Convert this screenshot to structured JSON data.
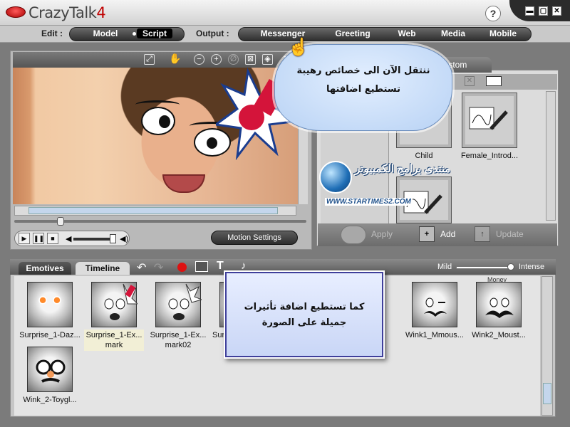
{
  "app": {
    "title_main": "CrazyTalk",
    "title_version": "4",
    "help": "?"
  },
  "window_controls": {
    "minimize": "▬",
    "maximize": "▢",
    "close": "✕"
  },
  "modebar": {
    "edit_label": "Edit :",
    "edit_items": [
      "Model",
      "Script"
    ],
    "output_label": "Output :",
    "output_items": [
      "Messenger",
      "Greeting",
      "Web",
      "Media",
      "Mobile"
    ],
    "selected": "Script"
  },
  "viewer": {
    "zoom_partial": "1",
    "motion_settings": "Motion Settings"
  },
  "library": {
    "tab_label": "Custom",
    "items": [
      {
        "label": "Child"
      },
      {
        "label": "Female_Introd..."
      }
    ],
    "actions": {
      "apply": "Apply",
      "add": "Add",
      "update": "Update"
    }
  },
  "watermark": {
    "text_arabic": "منتدى برامج الكمبيوتر",
    "url": "WWW.STARTIMES2.COM"
  },
  "callouts": {
    "cloud_line1": "ننتقل الآن الى خصائص رهيبة",
    "cloud_line2": "تستطيع اضافتها",
    "box_line1": "كما تستطيع اضافة تأثيرات",
    "box_line2": "جميلة على الصورة"
  },
  "bottom": {
    "tabs": [
      "Emotives",
      "Timeline"
    ],
    "intensity_low": "Mild",
    "intensity_high": "Intense",
    "partial_label": "Money",
    "faces": [
      {
        "line1": "Surprise_1-Daz...",
        "line2": ""
      },
      {
        "line1": "Surprise_1-Ex...",
        "line2": "mark"
      },
      {
        "line1": "Surprise_1-Ex...",
        "line2": "mark02"
      },
      {
        "line1": "Sur",
        "line2": ""
      },
      {
        "line1": "Wink1_Mmous...",
        "line2": ""
      },
      {
        "line1": "Wink2_Moust...",
        "line2": ""
      },
      {
        "line1": "Wink_2-Toygl...",
        "line2": ""
      }
    ]
  },
  "colors": {
    "brand_red": "#c00000",
    "panel_gray": "#c6c6c6",
    "cloud_blue": "#b8d2f4",
    "callout_border": "#3f3f9a"
  }
}
